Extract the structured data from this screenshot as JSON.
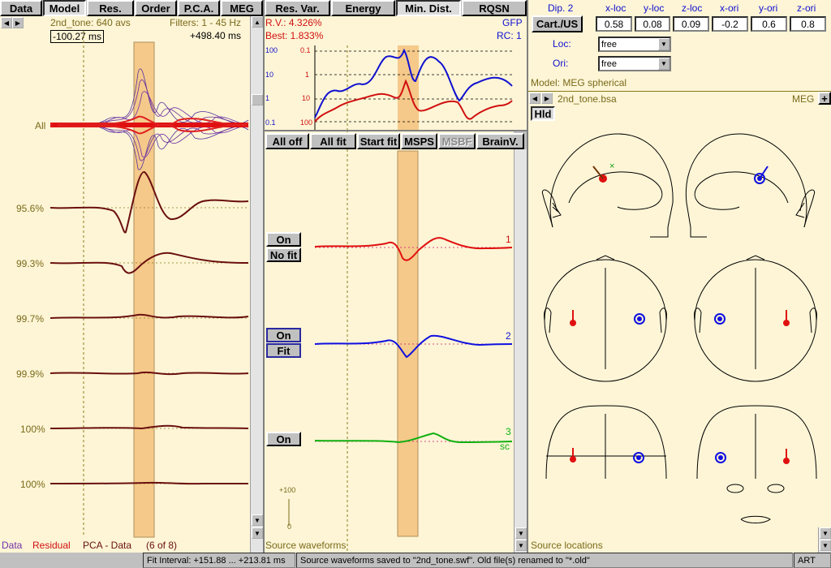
{
  "left": {
    "tabs": [
      "Data",
      "Model",
      "Res.",
      "Order",
      "P.C.A.",
      "MEG"
    ],
    "active_tab": 1,
    "header_left": "2nd_tone: 640 avs",
    "header_right": "Filters: 1 - 45 Hz",
    "time_start": "-100.27 ms",
    "time_end": "+498.40 ms",
    "all_label": "All",
    "pca_labels": [
      "95.6%",
      "99.3%",
      "99.7%",
      "99.9%",
      "100%",
      "100%"
    ],
    "footer_data": "Data",
    "footer_residual": "Residual",
    "footer_pca": "PCA - Data",
    "footer_count": "(6 of 8)"
  },
  "middle": {
    "tabs": [
      "Res. Var.",
      "Energy",
      "Min. Dist.",
      "RQSN"
    ],
    "active_tab": 2,
    "rv": "R.V.: 4.326%",
    "best": "Best: 1.833%",
    "gfp": "GFP",
    "rc": "RC: 1",
    "log_left": [
      "100",
      "10",
      "1",
      "0.1"
    ],
    "log_right": [
      "0.1",
      "1",
      "10",
      "100"
    ],
    "toolbar": [
      "All off",
      "All fit",
      "Start fit",
      "MSPS",
      "MSBF",
      "BrainV."
    ],
    "src1_on": "On",
    "src1_nofit": "No fit",
    "src2_on": "On",
    "src2_fit": "Fit",
    "src3_on": "On",
    "src_numbers": [
      "1",
      "2",
      "3"
    ],
    "sc_label": "sc",
    "scale_top": "+100",
    "scale_bottom": "0",
    "footer": "Source waveforms"
  },
  "right": {
    "dip_label": "Dip. 2",
    "col_headers": [
      "x-loc",
      "y-loc",
      "z-loc",
      "x-ori",
      "y-ori",
      "z-ori"
    ],
    "cart_btn": "Cart./US",
    "values": [
      "0.58",
      "0.08",
      "0.09",
      "-0.2",
      "0.6",
      "0.8"
    ],
    "loc_label": "Loc:",
    "loc_value": "free",
    "ori_label": "Ori:",
    "ori_value": "free",
    "model_text": "Model: MEG spherical",
    "file_name": "2nd_tone.bsa",
    "meg_label": "MEG",
    "plus": "+",
    "hld": "Hld",
    "footer": "Source locations"
  },
  "status": {
    "fit_interval": "Fit Interval: +151.88 ... +213.81 ms",
    "message": "Source waveforms saved to \"2nd_tone.swf\". Old file(s) renamed to \"*.old\"",
    "mode": "ART"
  },
  "colors": {
    "panel": "#fdf5d6",
    "red": "#d01010",
    "blue": "#1010d0",
    "green": "#10b010",
    "maroon": "#6a0f0f",
    "highlight": "#f5c98a"
  }
}
